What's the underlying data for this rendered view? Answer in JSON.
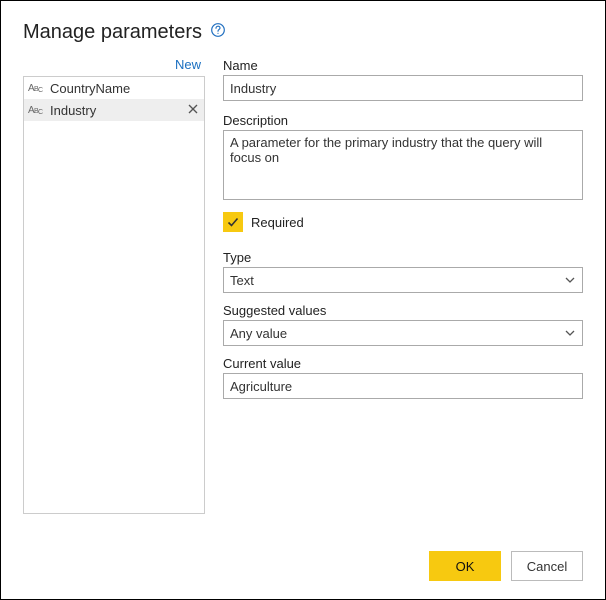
{
  "title": "Manage parameters",
  "new_link": "New",
  "parameters": {
    "items": [
      {
        "label": "CountryName"
      },
      {
        "label": "Industry"
      }
    ]
  },
  "form": {
    "name_label": "Name",
    "name_value": "Industry",
    "description_label": "Description",
    "description_value": "A parameter for the primary industry that the query will focus on",
    "required_label": "Required",
    "type_label": "Type",
    "type_value": "Text",
    "suggested_label": "Suggested values",
    "suggested_value": "Any value",
    "current_label": "Current value",
    "current_value": "Agriculture"
  },
  "buttons": {
    "ok": "OK",
    "cancel": "Cancel"
  }
}
